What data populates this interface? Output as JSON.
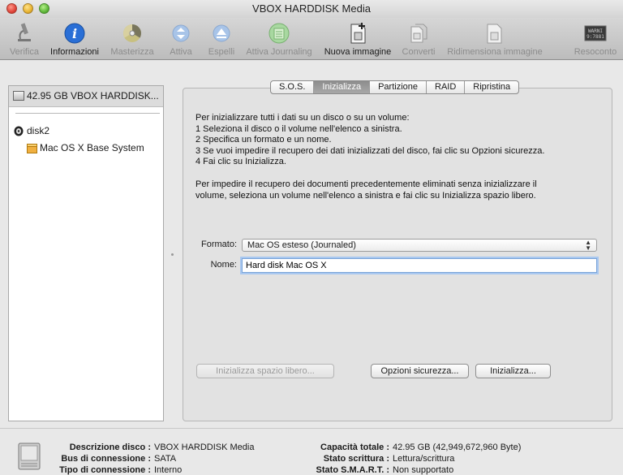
{
  "window": {
    "title": "VBOX HARDDISK Media"
  },
  "toolbar": {
    "items": [
      {
        "label": "Verifica",
        "icon": "microscope-icon",
        "enabled": false
      },
      {
        "label": "Informazioni",
        "icon": "info-icon",
        "enabled": true
      },
      {
        "label": "Masterizza",
        "icon": "burn-icon",
        "enabled": false
      },
      {
        "label": "Attiva",
        "icon": "mount-icon",
        "enabled": false
      },
      {
        "label": "Espelli",
        "icon": "eject-icon",
        "enabled": false
      },
      {
        "label": "Attiva Journaling",
        "icon": "journal-icon",
        "enabled": false
      },
      {
        "label": "Nuova immagine",
        "icon": "new-image-icon",
        "enabled": true
      },
      {
        "label": "Converti",
        "icon": "convert-icon",
        "enabled": false
      },
      {
        "label": "Ridimensiona immagine",
        "icon": "resize-icon",
        "enabled": false
      },
      {
        "label": "Resoconto",
        "icon": "log-icon",
        "enabled": false,
        "icon_text": "WARNI\n9:7881"
      }
    ]
  },
  "sidebar": {
    "header": "42.95 GB VBOX HARDDISK...",
    "items": [
      {
        "label": "disk2",
        "icon": "disk-image-icon"
      },
      {
        "label": "Mac OS X Base System",
        "icon": "volume-icon"
      }
    ]
  },
  "tabs": [
    {
      "label": "S.O.S.",
      "active": false
    },
    {
      "label": "Inizializza",
      "active": true
    },
    {
      "label": "Partizione",
      "active": false
    },
    {
      "label": "RAID",
      "active": false
    },
    {
      "label": "Ripristina",
      "active": false
    }
  ],
  "erase": {
    "instructions": [
      "Per inizializzare tutti i dati su un disco o su un volume:",
      "1 Seleziona il disco o il volume nell'elenco a sinistra.",
      "2 Specifica un formato e un nome.",
      "3 Se vuoi impedire il recupero dei dati inizializzati del disco, fai clic su Opzioni sicurezza.",
      "4 Fai clic su Inizializza."
    ],
    "note": [
      "Per impedire il recupero dei documenti precedentemente eliminati senza inizializzare il",
      "volume, seleziona un volume nell'elenco a sinistra e fai clic su Inizializza spazio libero."
    ],
    "format_label": "Formato:",
    "format_value": "Mac OS esteso (Journaled)",
    "name_label": "Nome:",
    "name_value": "Hard disk Mac OS X",
    "btn_free_space": "Inizializza spazio libero...",
    "btn_security": "Opzioni sicurezza...",
    "btn_erase": "Inizializza..."
  },
  "info": {
    "left": [
      {
        "key": "Descrizione disco :",
        "value": "VBOX HARDDISK Media"
      },
      {
        "key": "Bus di connessione :",
        "value": "SATA"
      },
      {
        "key": "Tipo di connessione :",
        "value": "Interno"
      }
    ],
    "right": [
      {
        "key": "Capacità totale :",
        "value": "42.95 GB (42,949,672,960 Byte)"
      },
      {
        "key": "Stato scrittura :",
        "value": "Lettura/scrittura"
      },
      {
        "key": "Stato S.M.A.R.T. :",
        "value": "Non supportato"
      }
    ]
  },
  "colors": {
    "accent": "#7aa4d8",
    "tab_active": "#9a9a9a",
    "info_blue": "#2a6fd6"
  }
}
